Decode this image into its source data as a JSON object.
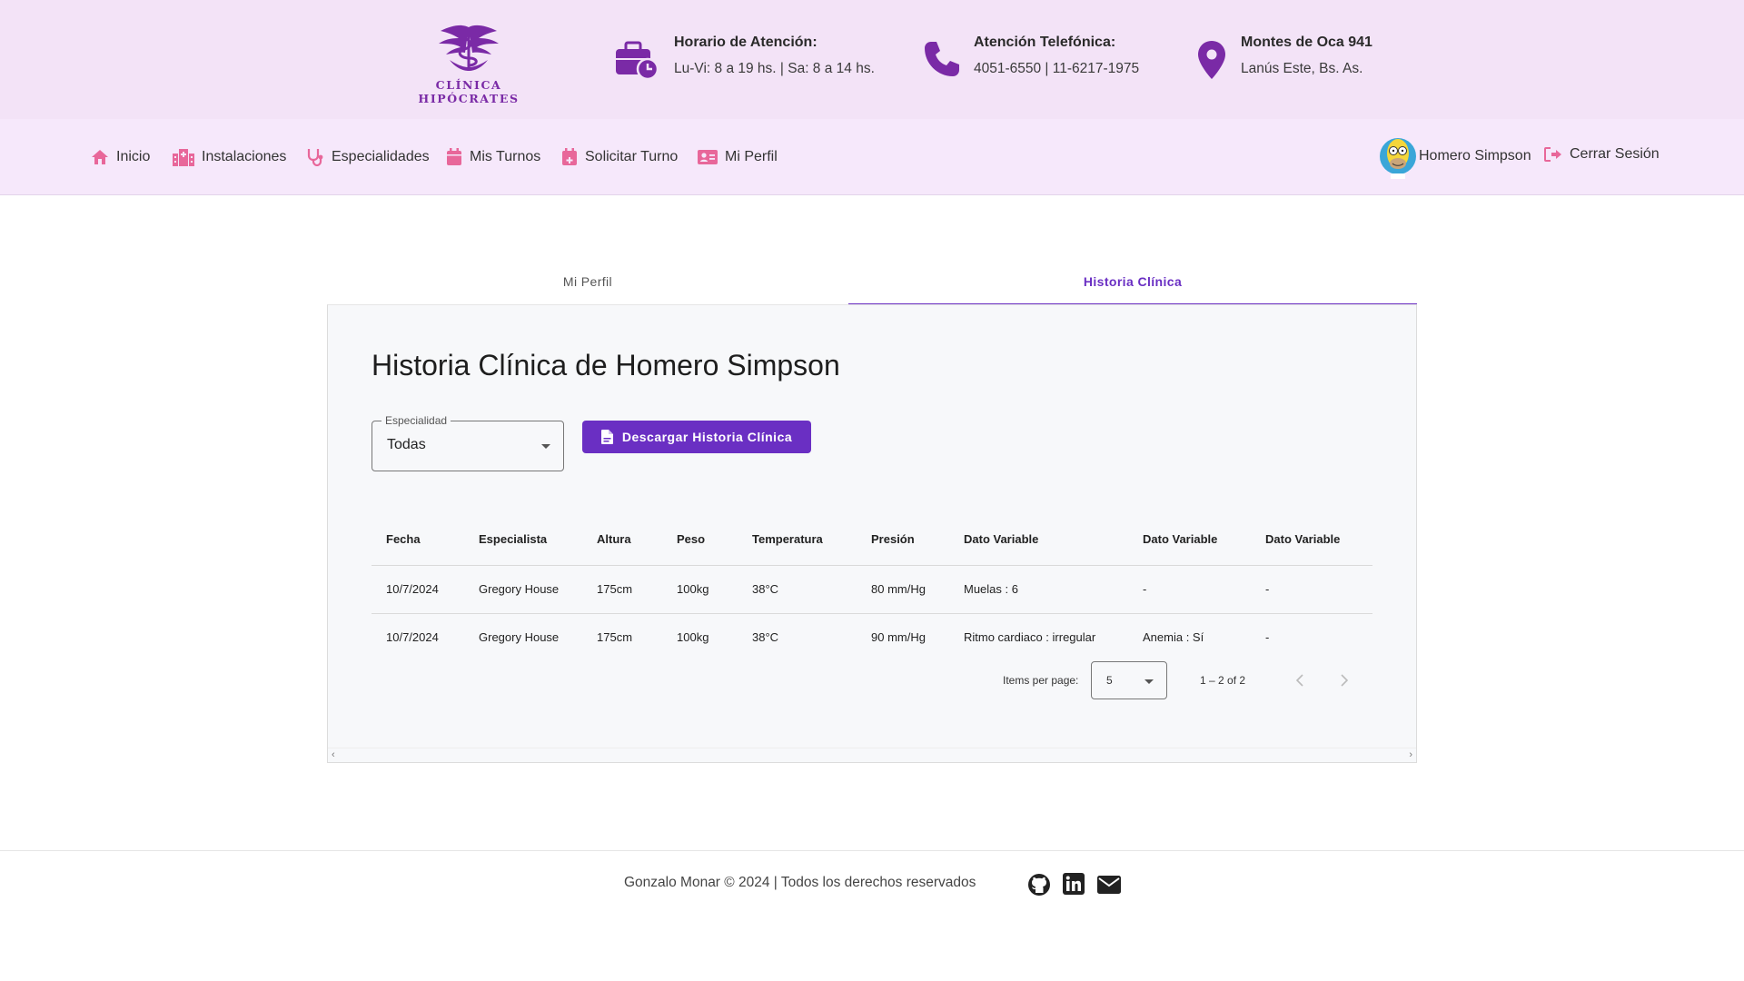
{
  "brand": {
    "name": "CLÍNICA HIPÓCRATES",
    "color": "#7a2aa6"
  },
  "header": {
    "schedule": {
      "icon": "briefcase-clock-icon",
      "title": "Horario de Atención:",
      "value": "Lu-Vi: 8 a 19 hs. | Sa: 8 a 14 hs."
    },
    "phone": {
      "icon": "phone-icon",
      "title": "Atención Telefónica:",
      "value": "4051-6550 | 11-6217-1975"
    },
    "address": {
      "icon": "map-pin-icon",
      "title": "Montes de Oca 941",
      "value": "Lanús Este, Bs. As."
    }
  },
  "nav": {
    "items": [
      {
        "label": "Inicio",
        "icon": "home-icon"
      },
      {
        "label": "Instalaciones",
        "icon": "hospital-icon"
      },
      {
        "label": "Especialidades",
        "icon": "stethoscope-icon"
      },
      {
        "label": "Mis Turnos",
        "icon": "calendar-icon"
      },
      {
        "label": "Solicitar Turno",
        "icon": "calendar-plus-icon"
      },
      {
        "label": "Mi Perfil",
        "icon": "id-card-icon"
      }
    ],
    "user_name": "Homero Simpson",
    "logout_label": "Cerrar Sesión",
    "icon_color": "#e8679a"
  },
  "tabs": [
    {
      "label": "Mi Perfil"
    },
    {
      "label": "Historia Clínica",
      "active": true
    }
  ],
  "history": {
    "title": "Historia Clínica de Homero Simpson",
    "filter": {
      "label": "Especialidad",
      "value": "Todas"
    },
    "download_label": "Descargar Historia Clínica",
    "accent": "#6a2fc3",
    "columns": [
      "Fecha",
      "Especialista",
      "Altura",
      "Peso",
      "Temperatura",
      "Presión",
      "Dato Variable",
      "Dato Variable",
      "Dato Variable"
    ],
    "rows": [
      [
        "10/7/2024",
        "Gregory House",
        "175cm",
        "100kg",
        "38°C",
        "80 mm/Hg",
        "Muelas : 6",
        "-",
        "-"
      ],
      [
        "10/7/2024",
        "Gregory House",
        "175cm",
        "100kg",
        "38°C",
        "90 mm/Hg",
        "Ritmo cardiaco : irregular",
        "Anemia : Sí",
        "-"
      ]
    ],
    "paginator": {
      "label": "Items per page:",
      "page_size": "5",
      "range": "1 – 2 of 2"
    }
  },
  "footer": {
    "text": "Gonzalo Monar © 2024 | Todos los derechos reservados",
    "icons": [
      "github-icon",
      "linkedin-icon",
      "envelope-icon"
    ]
  }
}
